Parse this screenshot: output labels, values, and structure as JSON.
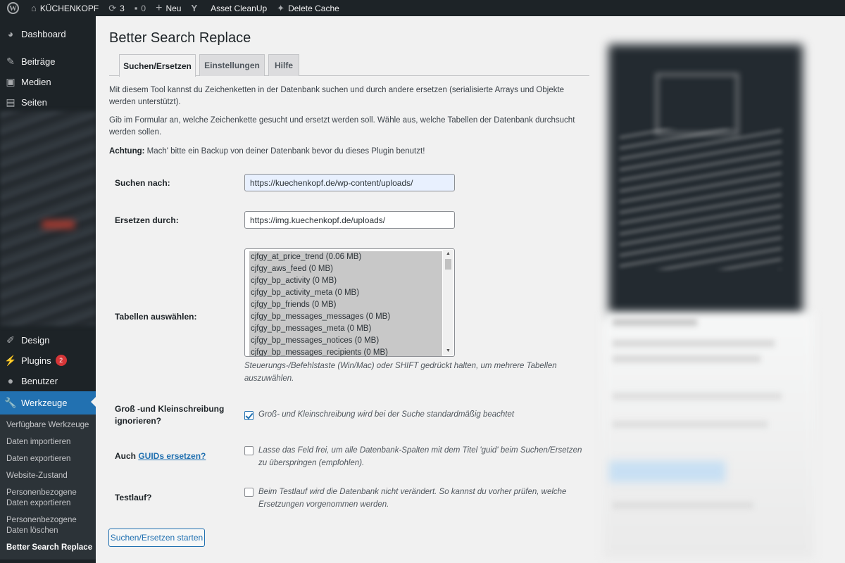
{
  "adminbar": {
    "site_name": "KÜCHENKOPF",
    "updates_count": "3",
    "comments_count": "0",
    "new_label": "Neu",
    "asset_cleanup": "Asset CleanUp",
    "delete_cache": "Delete Cache"
  },
  "sidebar": {
    "items": {
      "dashboard": "Dashboard",
      "beitraege": "Beiträge",
      "medien": "Medien",
      "seiten": "Seiten",
      "design": "Design",
      "plugins": "Plugins",
      "plugins_badge": "2",
      "benutzer": "Benutzer",
      "werkzeuge": "Werkzeuge"
    },
    "submenu": {
      "verfuegbar": "Verfügbare Werkzeuge",
      "import": "Daten importieren",
      "export": "Daten exportieren",
      "zustand": "Website-Zustand",
      "pers_export_1": "Personenbezogene",
      "pers_export_2": "Daten exportieren",
      "pers_delete_1": "Personenbezogene",
      "pers_delete_2": "Daten löschen",
      "bsr": "Better Search Replace"
    }
  },
  "page": {
    "title": "Better Search Replace",
    "tabs": {
      "search": "Suchen/Ersetzen",
      "settings": "Einstellungen",
      "help": "Hilfe"
    },
    "intro1": "Mit diesem Tool kannst du Zeichenketten in der Datenbank suchen und durch andere ersetzen (serialisierte Arrays und Objekte werden unterstützt).",
    "intro2": "Gib im Formular an, welche Zeichenkette gesucht und ersetzt werden soll. Wähle aus, welche Tabellen der Datenbank durchsucht werden sollen.",
    "warning_strong": "Achtung:",
    "warning_text": " Mach' bitte ein Backup von deiner Datenbank bevor du dieses Plugin benutzt!"
  },
  "form": {
    "search_label": "Suchen nach:",
    "search_value": "https://kuechenkopf.de/wp-content/uploads/",
    "replace_label": "Ersetzen durch:",
    "replace_value": "https://img.kuechenkopf.de/uploads/",
    "tables_label": "Tabellen auswählen:",
    "tables": [
      "cjfgy_at_price_trend (0.06 MB)",
      "cjfgy_aws_feed (0 MB)",
      "cjfgy_bp_activity (0 MB)",
      "cjfgy_bp_activity_meta (0 MB)",
      "cjfgy_bp_friends (0 MB)",
      "cjfgy_bp_messages_messages (0 MB)",
      "cjfgy_bp_messages_meta (0 MB)",
      "cjfgy_bp_messages_notices (0 MB)",
      "cjfgy_bp_messages_recipients (0 MB)"
    ],
    "tables_help": "Steuerungs-/Befehlstaste (Win/Mac) oder SHIFT gedrückt halten, um mehrere Tabellen auszuwählen.",
    "case_label": "Groß -und Kleinschreibung ignorieren?",
    "case_checked": true,
    "case_text": "Groß- und Kleinschreibung wird bei der Suche standardmäßig beachtet",
    "guid_label_prefix": "Auch ",
    "guid_label_link": "GUIDs ersetzen?",
    "guid_checked": false,
    "guid_text": "Lasse das Feld frei, um alle Datenbank-Spalten mit dem Titel 'guid' beim Suchen/Ersetzen zu überspringen (empfohlen).",
    "dry_label": "Testlauf?",
    "dry_checked": false,
    "dry_text": "Beim Testlauf wird die Datenbank nicht verändert. So kannst du vorher prüfen, welche Ersetzungen vorgenommen werden.",
    "submit": "Suchen/Ersetzen starten"
  },
  "colors": {
    "adminbar_bg": "#1d2327",
    "active_menu": "#2271b1",
    "badge": "#d63638",
    "content_bg": "#f1f1f1"
  }
}
